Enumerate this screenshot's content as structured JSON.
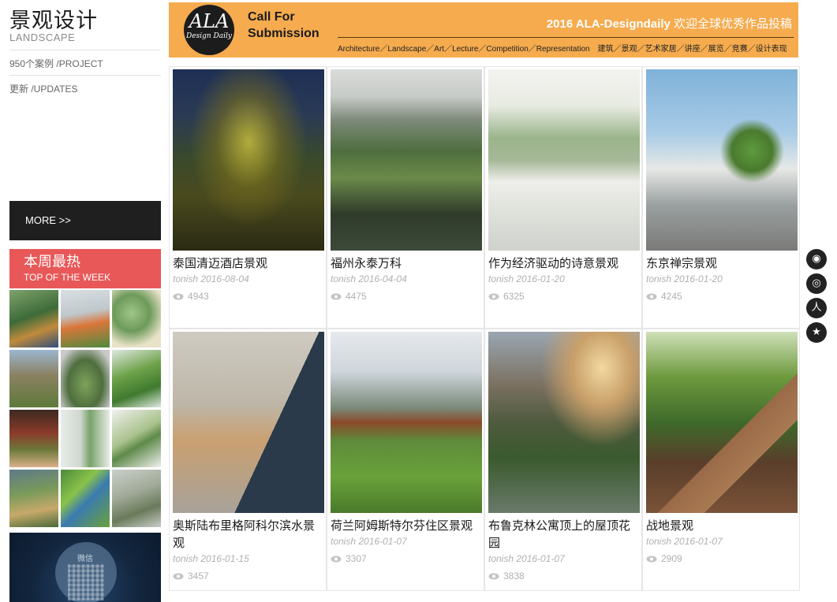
{
  "sidebar": {
    "title": "景观设计",
    "subtitle": "LANDSCAPE",
    "project_link": "950个案例 /PROJECT",
    "updates_link": "更新 /UPDATES",
    "more_button": "MORE >>",
    "top_week_zh": "本周最热",
    "top_week_en": "TOP OF THE WEEK",
    "wechat_label": "微信"
  },
  "banner": {
    "logo_main": "ALA",
    "logo_sub": "Design Daily",
    "call_for": "Call For",
    "submission": "Submission",
    "headline_en": "2016 ALA-Designdaily",
    "headline_zh": " 欢迎全球优秀作品投稿",
    "categories": "Architecture／Landscape／Art／Lecture／Competition／Representation　建筑／景观／艺术家居／讲座／展览／竞赛／设计表现"
  },
  "cards": [
    {
      "title": "泰国清迈酒店景观",
      "meta": "tonish 2016-08-04",
      "views": "4943"
    },
    {
      "title": "福州永泰万科",
      "meta": "tonish 2016-04-04",
      "views": "4475"
    },
    {
      "title": "作为经济驱动的诗意景观",
      "meta": "tonish 2016-01-20",
      "views": "6325"
    },
    {
      "title": "东京禅宗景观",
      "meta": "tonish 2016-01-20",
      "views": "4245"
    },
    {
      "title": "奥斯陆布里格阿科尔滨水景观",
      "meta": "tonish 2016-01-15",
      "views": "3457"
    },
    {
      "title": "荷兰阿姆斯特尔芬住区景观",
      "meta": "tonish 2016-01-07",
      "views": "3307"
    },
    {
      "title": "布鲁克林公寓顶上的屋顶花园",
      "meta": "tonish 2016-01-07",
      "views": "3838"
    },
    {
      "title": "战地景观",
      "meta": "tonish 2016-01-07",
      "views": "2909"
    }
  ],
  "share_icons": [
    "weibo-icon",
    "tencent-weibo-icon",
    "renren-icon",
    "favorite-star-icon"
  ],
  "share_glyphs": [
    "◉",
    "◎",
    "人",
    "★"
  ],
  "colors": {
    "banner_bg": "#f5ab4e",
    "more_bg": "#1f1f1f",
    "hot_bg": "#e85858",
    "meta_text": "#b0b0b0"
  }
}
